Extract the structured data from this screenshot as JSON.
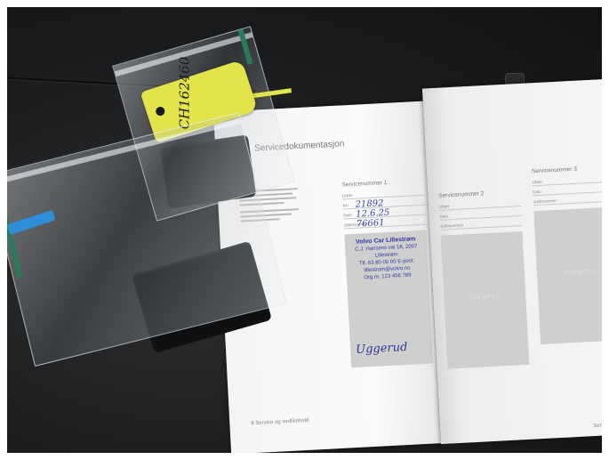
{
  "scene": {
    "tag_code": "CH162460",
    "booklet": {
      "title": "Servicedokumentasjon",
      "footer_left": "8 Service og vedlikehold",
      "footer_right": "Service og ved",
      "services": [
        {
          "heading": "Servicenummer 1",
          "fields": [
            {
              "label": "Utført",
              "value": ""
            },
            {
              "label": "km",
              "value": "21892"
            },
            {
              "label": "Dato",
              "value": "12.6.25"
            },
            {
              "label": "Jobbnummer",
              "value": "76661"
            }
          ],
          "stamp": {
            "dealer": "Volvo Car Lillestrøm",
            "address": "C.J. Hansens vei 18, 2007 Lillestrøm",
            "contact": "Tlf. 63 80 00 00 E-post: lillestrom@volvo.no",
            "org": "Org.nr. 123 456 789",
            "signature": "Uggerud"
          }
        },
        {
          "heading": "Servicenummer 2",
          "fields": [
            {
              "label": "Utført",
              "value": ""
            },
            {
              "label": "Dato",
              "value": ""
            },
            {
              "label": "Jobbnummer",
              "value": ""
            }
          ],
          "watermark": "STEMPEL"
        },
        {
          "heading": "Servicenummer 3",
          "fields": [
            {
              "label": "Utført",
              "value": ""
            },
            {
              "label": "Dato",
              "value": ""
            },
            {
              "label": "Jobbnummer",
              "value": ""
            }
          ],
          "watermark": "STEMPEL"
        }
      ]
    }
  }
}
